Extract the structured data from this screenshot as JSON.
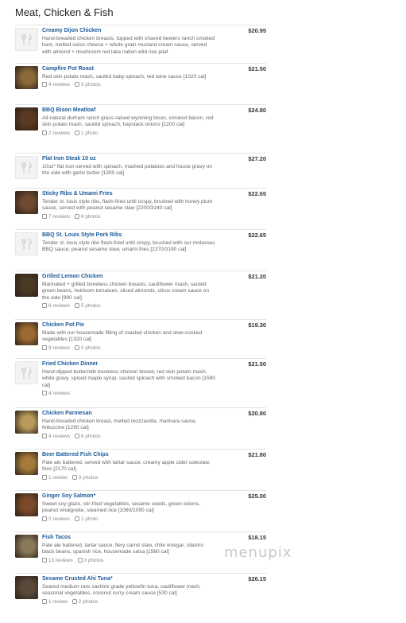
{
  "section": {
    "title": "Meat, Chicken & Fish"
  },
  "items": [
    {
      "name": "Creamy Dijon Chicken",
      "price": "$20.95",
      "photo": false,
      "desc": "Hand-breaded chicken breasts, topped with shaved beelers ranch smoked ham, melted swiss cheese + whole grain mustard cream sauce, served with almond + mushroom red lake nation wild rice pilaf",
      "reviews": "",
      "photos": ""
    },
    {
      "name": "Campfire Pot Roast",
      "price": "$21.50",
      "photo": true,
      "photo_color": "#8a6a3a",
      "desc": "Red skin potato mash, sautéd baby spinach, red wine sauce [1020 cal]",
      "reviews": "4 reviews",
      "photos": "3 photos"
    },
    {
      "name": "BBQ Bison Meatloaf",
      "price": "$24.80",
      "photo": true,
      "photo_color": "#5a3a22",
      "desc": "All-natural durham ranch grass-raised wyoming bison, smoked bacon, red skin potato mash, sautéd spinach, haystack onions [1200 cal]",
      "reviews": "2 reviews",
      "photos": "1 photo"
    },
    {
      "name": "Flat Iron Steak 10 oz",
      "price": "$27.20",
      "photo": false,
      "desc": "10oz* flat iron served with spinach, mashed potatoes and house gravy on the side with garlic butter [1300 cal]",
      "reviews": "",
      "photos": ""
    },
    {
      "name": "Sticky Ribs & Umami Fries",
      "price": "$22.65",
      "photo": true,
      "photo_color": "#6e4a30",
      "desc": "Tender st. louis style ribs, flash-fried until crispy, brushed with honey plum sauce, served with peanut sesame slaw [2200/3140 cal]",
      "reviews": "7 reviews",
      "photos": "6 photos"
    },
    {
      "name": "BBQ St. Louis Style Pork Ribs",
      "price": "$22.65",
      "photo": false,
      "desc": "Tender st. louis style ribs flash-fried until crispy, brushed with our molasses BBQ sauce, peanut sesame slaw, umami fries [2270/3190 cal]",
      "reviews": "",
      "photos": ""
    },
    {
      "name": "Grilled Lemon Chicken",
      "price": "$21.20",
      "photo": true,
      "photo_color": "#4a3a24",
      "desc": "Marinated + grilled boneless chicken breasts, cauliflower mash, sautéd green beans, heirloom tomatoes, sliced almonds, citrus cream sauce on the side [990 cal]",
      "reviews": "6 reviews",
      "photos": "5 photos"
    },
    {
      "name": "Chicken Pot Pie",
      "price": "$19.30",
      "photo": true,
      "photo_color": "#9a6a30",
      "desc": "Made with our housemade filling of roasted chicken and slow-cooked vegetables [1320 cal]",
      "reviews": "9 reviews",
      "photos": "5 photos"
    },
    {
      "name": "Fried Chicken Dinner",
      "price": "$21.50",
      "photo": false,
      "desc": "Hand-dipped buttermilk boneless chicken breast, red skin potato mash, white gravy, spiced maple syrup, sautéd spinach with smoked bacon [1590 cal]",
      "reviews": "4 reviews",
      "photos": ""
    },
    {
      "name": "Chicken Parmesan",
      "price": "$20.80",
      "photo": true,
      "photo_color": "#b89a5a",
      "desc": "Hand-breaded chicken breast, melted mozzarella, marinara sauce, fettuccine [1290 cal]",
      "reviews": "4 reviews",
      "photos": "6 photos"
    },
    {
      "name": "Beer Battered Fish Chips",
      "price": "$21.80",
      "photo": true,
      "photo_color": "#a47a3a",
      "desc": "Pale ale battered, served with tartar sauce, creamy apple cider coleslaw, fries [2170 cal]",
      "reviews": "1 review",
      "photos": "3 photos"
    },
    {
      "name": "Ginger Soy Salmon*",
      "price": "$25.00",
      "photo": true,
      "photo_color": "#7a4a2a",
      "desc": "Sweet soy glaze, stir-fried vegetables, sesame seeds, green onions, peanut vinaigrette, steamed rice [1060/1090 cal]",
      "reviews": "2 reviews",
      "photos": "1 photo"
    },
    {
      "name": "Fish Tacos",
      "price": "$18.15",
      "photo": true,
      "photo_color": "#8a7a5a",
      "desc": "Pale ale battered, tartar sauce, fiery carrot slaw, chile vinegar, cilantro black beans, spanish rice, housemade salsa [1560 cal]",
      "reviews": "13 reviews",
      "photos": "3 photos"
    },
    {
      "name": "Sesame Crusted Ahi Tuna*",
      "price": "$26.15",
      "photo": true,
      "photo_color": "#5a4a3a",
      "desc": "Seared medium-rare sashimi grade yellowfin tuna, cauliflower mash, seasonal vegetables, coconut curry cream sauce [530 cal]",
      "reviews": "1 review",
      "photos": "2 photos"
    }
  ],
  "watermark": "menupix"
}
